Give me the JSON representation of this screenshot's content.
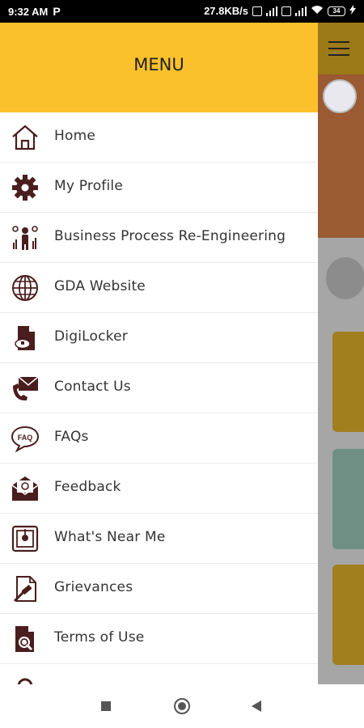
{
  "status_bar": {
    "time": "9:32 AM",
    "app_badge": "P",
    "speed": "27.8KB/s",
    "battery": "34"
  },
  "drawer": {
    "title": "MENU",
    "items": [
      {
        "label": "Home",
        "icon": "home-icon"
      },
      {
        "label": "My Profile",
        "icon": "gear-icon"
      },
      {
        "label": "Business Process Re-Engineering",
        "icon": "business-process-icon"
      },
      {
        "label": "GDA Website",
        "icon": "globe-icon"
      },
      {
        "label": "DigiLocker",
        "icon": "digilocker-icon"
      },
      {
        "label": "Contact Us",
        "icon": "contact-icon"
      },
      {
        "label": "FAQs",
        "icon": "faq-icon"
      },
      {
        "label": "Feedback",
        "icon": "feedback-icon"
      },
      {
        "label": "What's Near Me",
        "icon": "location-icon"
      },
      {
        "label": "Grievances",
        "icon": "grievance-icon"
      },
      {
        "label": "Terms of Use",
        "icon": "terms-icon"
      }
    ]
  },
  "colors": {
    "header": "#fbc12d",
    "icon": "#4a1e1e"
  }
}
